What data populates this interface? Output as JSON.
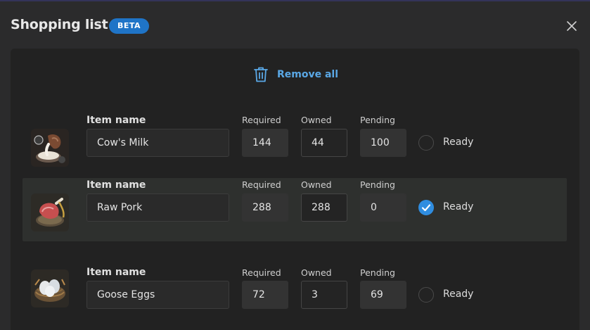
{
  "header": {
    "title": "Shopping list",
    "badge": "BETA"
  },
  "actions": {
    "remove_all_label": "Remove all"
  },
  "labels": {
    "item_name": "Item name",
    "required": "Required",
    "owned": "Owned",
    "pending": "Pending",
    "ready": "Ready"
  },
  "items": [
    {
      "name": "Cow's Milk",
      "required": "144",
      "owned": "44",
      "pending": "100",
      "ready": false,
      "icon": "milk-jug-icon"
    },
    {
      "name": "Raw Pork",
      "required": "288",
      "owned": "288",
      "pending": "0",
      "ready": true,
      "icon": "raw-pork-icon"
    },
    {
      "name": "Goose Eggs",
      "required": "72",
      "owned": "3",
      "pending": "69",
      "ready": false,
      "icon": "goose-eggs-icon"
    }
  ],
  "colors": {
    "accent": "#1f74c7",
    "link": "#5aa8e6",
    "checked": "#2f8de0",
    "background": "#2b2b2c",
    "panel": "#222222"
  }
}
